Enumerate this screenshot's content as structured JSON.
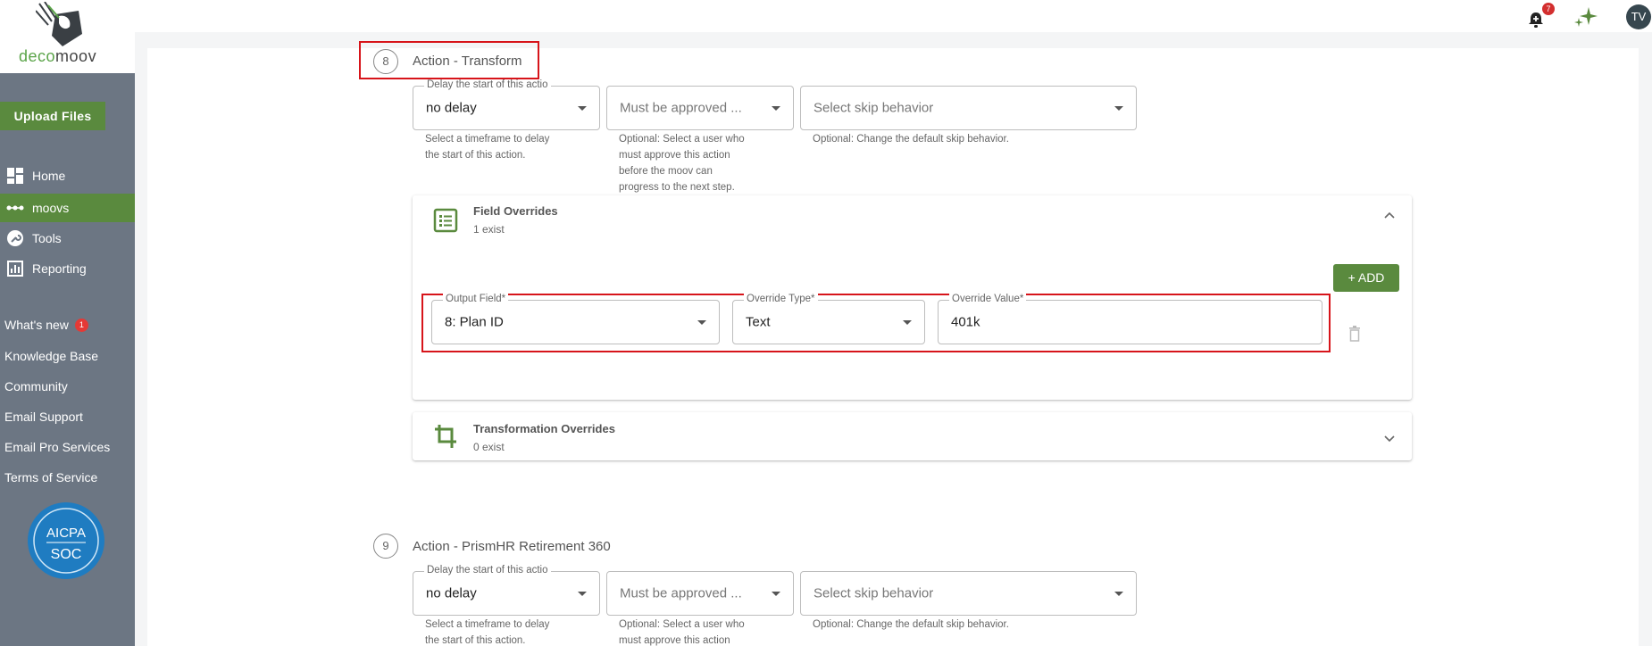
{
  "sidebar": {
    "logo": {
      "part_a": "deco",
      "part_b": "moov"
    },
    "upload_label": "Upload Files",
    "nav": [
      {
        "label": "Home",
        "icon": "dashboard-icon",
        "active": false
      },
      {
        "label": "moovs",
        "icon": "moovs-icon",
        "active": true
      },
      {
        "label": "Tools",
        "icon": "wrench-icon",
        "active": false
      },
      {
        "label": "Reporting",
        "icon": "report-icon",
        "active": false
      }
    ],
    "links": [
      {
        "label": "What's new",
        "badge": "1"
      },
      {
        "label": "Knowledge Base"
      },
      {
        "label": "Community"
      },
      {
        "label": "Email Support"
      },
      {
        "label": "Email Pro Services"
      },
      {
        "label": "Terms of Service"
      }
    ],
    "soc": {
      "line1": "AICPA",
      "line2": "SOC"
    }
  },
  "topbar": {
    "notifications": "7",
    "avatar": "TV"
  },
  "step8": {
    "number": "8",
    "title": "Action - Transform",
    "delay": {
      "legend": "Delay the start of this actio",
      "value": "no delay",
      "helper_1": "Select a timeframe to delay",
      "helper_2": "the start of this action."
    },
    "approver": {
      "value": "Must be approved ...",
      "helper_1": "Optional: Select a user who",
      "helper_2": "must approve this action",
      "helper_3": "before the moov can",
      "helper_4": "progress to the next step."
    },
    "skip": {
      "value": "Select skip behavior",
      "helper": "Optional: Change the default skip behavior."
    },
    "field_overrides": {
      "title": "Field Overrides",
      "count": "1 exist",
      "add_label": "+ ADD",
      "row": {
        "output_field": {
          "legend": "Output Field*",
          "value": "8: Plan ID"
        },
        "override_type": {
          "legend": "Override Type*",
          "value": "Text"
        },
        "override_value": {
          "legend": "Override Value*",
          "value": "401k"
        }
      }
    },
    "transformation_overrides": {
      "title": "Transformation Overrides",
      "count": "0 exist"
    }
  },
  "step9": {
    "number": "9",
    "title": "Action - PrismHR Retirement 360",
    "delay": {
      "legend": "Delay the start of this actio",
      "value": "no delay",
      "helper_1": "Select a timeframe to delay",
      "helper_2": "the start of this action."
    },
    "approver": {
      "value": "Must be approved ...",
      "helper_1": "Optional: Select a user who",
      "helper_2": "must approve this action"
    },
    "skip": {
      "value": "Select skip behavior",
      "helper": "Optional: Change the default skip behavior."
    }
  },
  "colors": {
    "accent": "#5a8a3e",
    "sidebar": "#6c7683",
    "highlight": "#d7141a",
    "badge": "#d32f2f"
  }
}
